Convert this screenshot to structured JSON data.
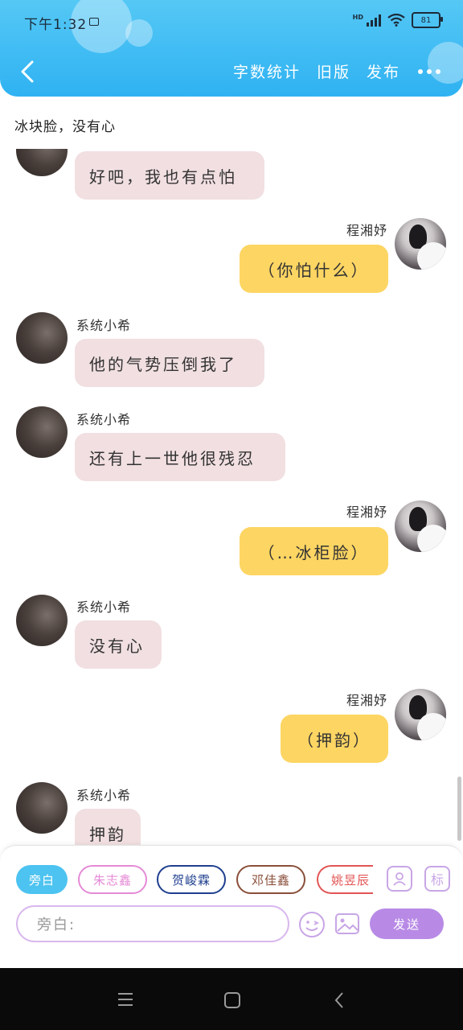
{
  "status_bar": {
    "time": "下午1:32",
    "network": "HD",
    "battery": "81"
  },
  "header": {
    "actions": [
      "字数统计",
      "旧版",
      "发布"
    ]
  },
  "subtitle": "冰块脸，没有心",
  "messages": [
    {
      "side": "left",
      "sender": "",
      "text": "好吧，我也有点怕"
    },
    {
      "side": "right",
      "sender": "程湘妤",
      "text": "（你怕什么）"
    },
    {
      "side": "left",
      "sender": "系统小希",
      "text": "他的气势压倒我了"
    },
    {
      "side": "left",
      "sender": "系统小希",
      "text": "还有上一世他很残忍"
    },
    {
      "side": "right",
      "sender": "程湘妤",
      "text": "（…冰柜脸）"
    },
    {
      "side": "left",
      "sender": "系统小希",
      "text": "没有心"
    },
    {
      "side": "right",
      "sender": "程湘妤",
      "text": "（押韵）"
    },
    {
      "side": "left",
      "sender": "系统小希",
      "text": "押韵"
    }
  ],
  "composer": {
    "chips": [
      {
        "label": "旁白",
        "color": "#4cc3f0",
        "filled": true
      },
      {
        "label": "朱志鑫",
        "color": "#e58ad6",
        "filled": false
      },
      {
        "label": "贺峻霖",
        "color": "#1f3f8f",
        "filled": false
      },
      {
        "label": "邓佳鑫",
        "color": "#8a4f3a",
        "filled": false
      },
      {
        "label": "姚昱辰",
        "color": "#e35555",
        "filled": false
      }
    ],
    "contact_icon": "person-card-icon",
    "tag_icon_label": "标",
    "input_placeholder": "旁白:",
    "emoji_icon": "emoji-icon",
    "image_icon": "image-icon",
    "send_label": "发送",
    "accent": "#b88ae6"
  },
  "nav": {
    "menu_icon": "menu-icon",
    "home_icon": "home-icon",
    "back_icon": "back-icon"
  }
}
